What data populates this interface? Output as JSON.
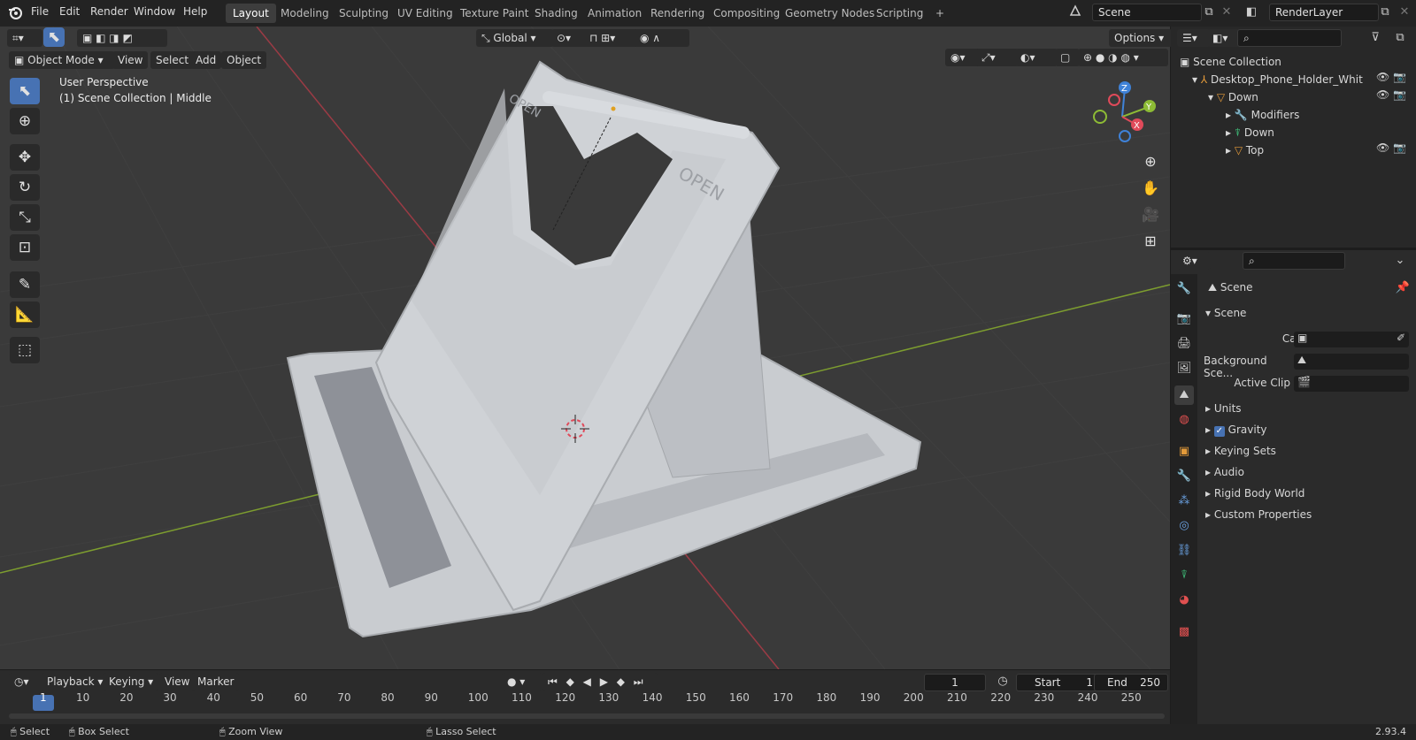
{
  "menu": [
    "File",
    "Edit",
    "Render",
    "Window",
    "Help"
  ],
  "workspaces": [
    "Layout",
    "Modeling",
    "Sculpting",
    "UV Editing",
    "Texture Paint",
    "Shading",
    "Animation",
    "Rendering",
    "Compositing",
    "Geometry Nodes",
    "Scripting"
  ],
  "active_workspace": "Layout",
  "plus_symbol": "+",
  "scene_name": "Scene",
  "view_layer": "RenderLayer",
  "viewport": {
    "mode": "Object Mode",
    "header_menus": [
      "View",
      "Select",
      "Add",
      "Object"
    ],
    "transform_orientation": "Global",
    "options_label": "Options",
    "perspective_text": "User Perspective",
    "collection_text": "(1) Scene Collection | Middle",
    "axes": {
      "x": "X",
      "y": "Y",
      "z": "Z"
    },
    "model_labels": [
      "OPEN",
      "OPEN"
    ]
  },
  "outliner": {
    "root": "Scene Collection",
    "rows": [
      {
        "label": "Desktop_Phone_Holder_Whit",
        "indent": 0
      },
      {
        "label": "Down",
        "indent": 1
      },
      {
        "label": "Modifiers",
        "indent": 2
      },
      {
        "label": "Down",
        "indent": 2
      },
      {
        "label": "Top",
        "indent": 2
      }
    ]
  },
  "properties": {
    "context": "Scene",
    "panel": "Scene",
    "fields": [
      {
        "label": "Camera"
      },
      {
        "label": "Background Sce..."
      },
      {
        "label": "Active Clip"
      }
    ],
    "sections": [
      "Units",
      "Gravity",
      "Keying Sets",
      "Audio",
      "Rigid Body World",
      "Custom Properties"
    ],
    "gravity_checked": true
  },
  "timeline": {
    "menus": [
      "Playback",
      "Keying",
      "View",
      "Marker"
    ],
    "current_frame": "1",
    "start_label": "Start",
    "start": "1",
    "end_label": "End",
    "end": "250",
    "ticks": [
      "1",
      "10",
      "20",
      "30",
      "40",
      "50",
      "60",
      "70",
      "80",
      "90",
      "100",
      "110",
      "120",
      "130",
      "140",
      "150",
      "160",
      "170",
      "180",
      "190",
      "200",
      "210",
      "220",
      "230",
      "240",
      "250"
    ]
  },
  "statusbar": {
    "items": [
      "Select",
      "Box Select",
      "Zoom View",
      "Lasso Select"
    ],
    "version": "2.93.4"
  },
  "colors": {
    "accent": "#4772b3",
    "x_axis": "#e04a5a",
    "y_axis": "#8dbb35",
    "z_axis": "#3f82d8",
    "viewport_bg": "#3a3a3a"
  }
}
